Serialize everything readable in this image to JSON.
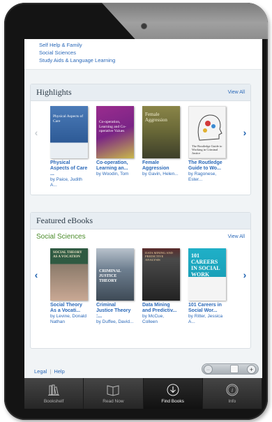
{
  "categories": [
    "Self Help & Family",
    "Social Sciences",
    "Study Aids & Language Learning"
  ],
  "highlights": {
    "title": "Highlights",
    "view_all": "View All",
    "books": [
      {
        "title": "Physical Aspects of Care ...",
        "author": "by Paice, Judith A...",
        "cover_text": "Physical Aspects of Care",
        "cover_color": "#3a6aa6"
      },
      {
        "title": "Co-operation, Learning an...",
        "author": "by Woodin, Tom",
        "cover_text": "Co-operation, Learning and Co-operative Values",
        "cover_color": "#8a2a86"
      },
      {
        "title": "Female Aggression",
        "author": "by Gavin, Helen...",
        "cover_text": "Female Aggression",
        "cover_color": "#6f6a3a"
      },
      {
        "title": "The Routledge Guide to Wo...",
        "author": "by Ragonese, Ester...",
        "cover_text": "The Routledge Guide to Working in Criminal Justice",
        "cover_color": "#f2f2f2"
      }
    ]
  },
  "featured": {
    "title": "Featured eBooks",
    "subtitle": "Social Sciences",
    "view_all": "View All",
    "books": [
      {
        "title": "Social Theory As a Vocati...",
        "author": "by Levine, Donald Nathan",
        "cover_text": "SOCIAL THEORY AS A VOCATION",
        "cover_color": "#2f4f3a"
      },
      {
        "title": "Criminal Justice Theory :...",
        "author": "by Duffee, David...",
        "cover_text": "CRIMINAL JUSTICE THEORY",
        "cover_color": "#5b6b7b"
      },
      {
        "title": "Data Mining and Predictiv...",
        "author": "by McCue, Colleen",
        "cover_text": "DATA MINING AND PREDICTIVE ANALYSIS",
        "cover_color": "#3c3c3c"
      },
      {
        "title": "101 Careers in Social Wor...",
        "author": "by Ritter, Jessica A...",
        "cover_text": "101 CAREERS IN SOCIAL WORK",
        "cover_color": "#1aa0b8"
      }
    ]
  },
  "footer": {
    "legal": "Legal",
    "separator": "|",
    "help": "Help"
  },
  "zoom": {
    "minus": "−",
    "plus": "+"
  },
  "tabs": [
    {
      "label": "Bookshelf",
      "icon": "bookshelf-icon"
    },
    {
      "label": "Read Now",
      "icon": "open-book-icon"
    },
    {
      "label": "Find Books",
      "icon": "download-icon"
    },
    {
      "label": "Info",
      "icon": "info-icon"
    }
  ],
  "active_tab": "Find Books"
}
